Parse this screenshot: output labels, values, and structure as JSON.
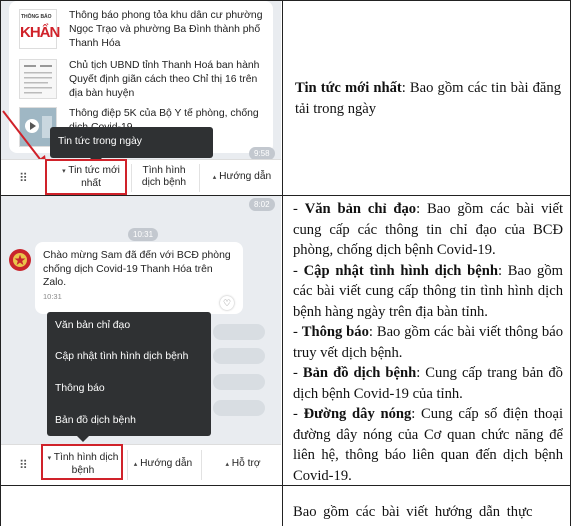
{
  "row1": {
    "news": [
      "Thông báo phong tỏa khu dân cư phường Ngọc Trạo và phường Ba Đình thành phố Thanh Hóa",
      "Chủ tịch UBND tỉnh Thanh Hoá ban hành Quyết định giãn cách theo Chỉ thị 16 trên địa bàn huyện",
      "Thông điệp 5K của Bộ Y tế phòng, chống dịch Covid-19"
    ],
    "thumb1_logo": "THÔNG BÁO",
    "thumb1_brand": "KHẨN",
    "popup_item": "Tin tức trong ngày",
    "time": "9:58",
    "tabs": [
      "Tin tức mới nhất",
      "Tình hình dịch bệnh",
      "Hướng dẫn"
    ],
    "desc_bold": "Tin tức mới nhất",
    "desc_rest": ": Bao gồm các tin bài đăng tải trong ngày"
  },
  "row2": {
    "time_top": "8:02",
    "time_mid": "10:31",
    "welcome": "Chào mừng Sam đã đến với BCĐ phòng chống dịch Covid-19 Thanh Hóa trên Zalo.",
    "welcome_time": "10:31",
    "popup_items": [
      "Văn bản chỉ đạo",
      "Cập nhật tình hình dịch bệnh",
      "Thông báo",
      "Bản đồ dịch bệnh"
    ],
    "tabs": [
      "Tình hình dịch bệnh",
      "Hướng dẫn",
      "Hỗ trợ"
    ],
    "items": [
      {
        "bold": "Văn bản chỉ đạo",
        "rest": ": Bao gồm các bài viết cung cấp các thông tin chỉ đạo của BCĐ phòng, chống dịch bệnh Covid-19."
      },
      {
        "bold": "Cập nhật tình hình dịch bệnh",
        "rest": ": Bao gồm các bài viết cung cấp thông tin tình hình dịch bệnh hàng ngày trên địa bàn tỉnh."
      },
      {
        "bold": "Thông báo",
        "rest": ": Bao gồm các bài viết thông báo truy vết dịch bệnh."
      },
      {
        "bold": "Bản đồ dịch bệnh",
        "rest": ": Cung cấp trang bản đồ dịch bệnh Covid-19 của tỉnh."
      },
      {
        "bold": "Đường dây nóng",
        "rest": ": Cung cấp số điện thoại đường dây nóng của Cơ quan chức năng để liên hệ, thông báo liên quan đến dịch bệnh Covid-19."
      }
    ]
  },
  "row3": {
    "desc": "Bao gồm các bài viết hướng dẫn thực"
  },
  "colors": {
    "red": "#d0222a",
    "popup": "#2f3133",
    "chat_bg": "#e9ecf0"
  }
}
